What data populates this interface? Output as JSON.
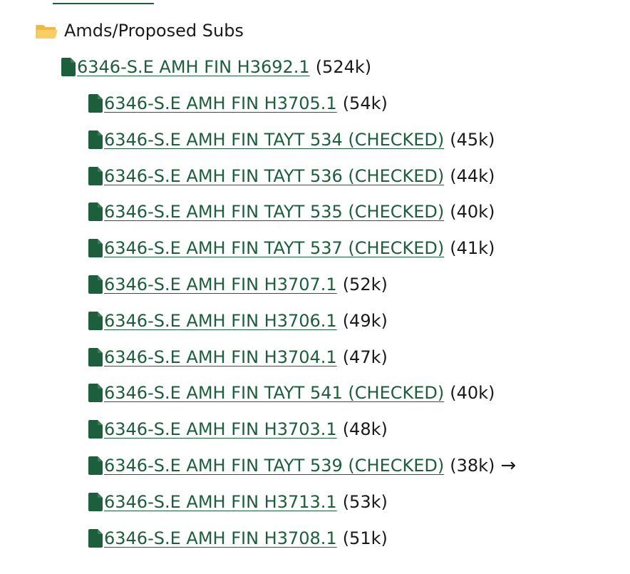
{
  "folder": {
    "icon": "open-folder-icon",
    "label": "Amds/Proposed Subs",
    "color": "#f2c65c"
  },
  "link_color": "#1d5e3c",
  "parent_file": {
    "icon": "file-icon",
    "name": "6346-S.E AMH FIN H3692.1",
    "size": "(524k)"
  },
  "children": [
    {
      "name": "6346-S.E AMH FIN H3705.1",
      "size": "(54k)"
    },
    {
      "name": "6346-S.E AMH FIN TAYT 534 (CHECKED)",
      "size": "(45k)"
    },
    {
      "name": "6346-S.E AMH FIN TAYT 536 (CHECKED)",
      "size": "(44k)"
    },
    {
      "name": "6346-S.E AMH FIN TAYT 535 (CHECKED)",
      "size": "(40k)"
    },
    {
      "name": "6346-S.E AMH FIN TAYT 537 (CHECKED)",
      "size": "(41k)"
    },
    {
      "name": "6346-S.E AMH FIN H3707.1",
      "size": "(52k)"
    },
    {
      "name": "6346-S.E AMH FIN H3706.1",
      "size": "(49k)"
    },
    {
      "name": "6346-S.E AMH FIN H3704.1",
      "size": "(47k)"
    },
    {
      "name": "6346-S.E AMH FIN TAYT 541 (CHECKED)",
      "size": "(40k)"
    },
    {
      "name": "6346-S.E AMH FIN H3703.1",
      "size": "(48k)"
    },
    {
      "name": "6346-S.E AMH FIN TAYT 539 (CHECKED)",
      "size": "(38k)",
      "arrow": "→"
    },
    {
      "name": "6346-S.E AMH FIN H3713.1",
      "size": "(53k)"
    },
    {
      "name": "6346-S.E AMH FIN H3708.1",
      "size": "(51k)"
    }
  ]
}
